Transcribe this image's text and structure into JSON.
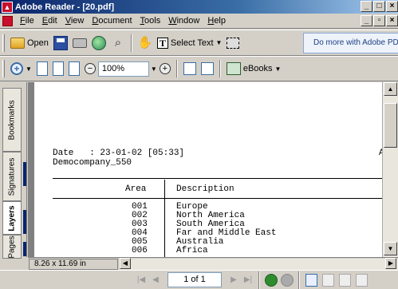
{
  "window": {
    "title": "Adobe Reader - [20.pdf]"
  },
  "menu": [
    {
      "label": "File",
      "key": "F",
      "rest": "ile"
    },
    {
      "label": "Edit",
      "key": "E",
      "rest": "dit"
    },
    {
      "label": "View",
      "key": "V",
      "rest": "iew"
    },
    {
      "label": "Document",
      "key": "D",
      "rest": "ocument"
    },
    {
      "label": "Tools",
      "key": "T",
      "rest": "ools"
    },
    {
      "label": "Window",
      "key": "W",
      "rest": "indow"
    },
    {
      "label": "Help",
      "key": "H",
      "rest": "elp"
    }
  ],
  "toolbar": {
    "open_label": "Open",
    "select_text_label": "Select Text",
    "promo_label": "Do more with Adobe PDF",
    "zoom_value": "100%",
    "ebooks_label": "eBooks"
  },
  "sidetabs": [
    "Bookmarks",
    "Signatures",
    "Layers",
    "Pages"
  ],
  "document": {
    "date_line": "Date   : 23-01-02 [05:33]",
    "company_line": "Democompany_550",
    "right_fragment": "AR",
    "table_headers": {
      "area": "Area",
      "description": "Description"
    },
    "rows": [
      {
        "area": "001",
        "description": "Europe"
      },
      {
        "area": "002",
        "description": "North America"
      },
      {
        "area": "003",
        "description": "South America"
      },
      {
        "area": "004",
        "description": "Far and Middle East"
      },
      {
        "area": "005",
        "description": "Australia"
      },
      {
        "area": "006",
        "description": "Africa"
      }
    ]
  },
  "page_size": "8.26 x 11.69 in",
  "navigation": {
    "page_indicator": "1 of 1"
  }
}
